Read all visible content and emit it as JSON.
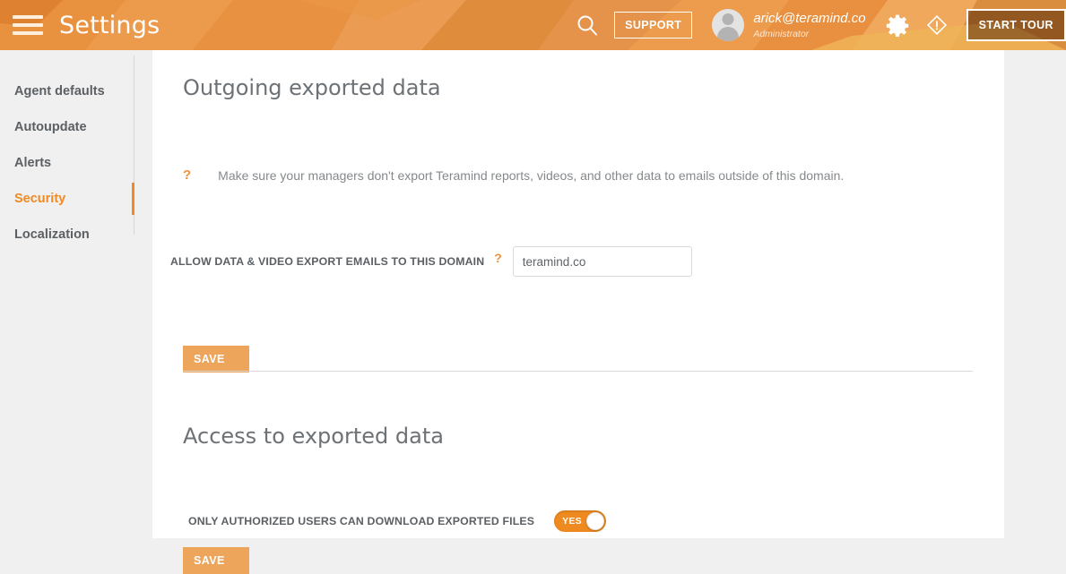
{
  "header": {
    "menu_icon": "hamburger-menu-icon",
    "title": "Settings",
    "search_icon": "search-icon",
    "support_label": "SUPPORT",
    "user_email": "arick@teramind.co",
    "user_role": "Administrator",
    "gear_icon": "gear-icon",
    "alert_icon": "alert-diamond-icon",
    "start_tour_label": "START TOUR",
    "accent_color": "#e78c3c"
  },
  "sidebar": {
    "items": [
      {
        "label": "Agent defaults",
        "active": false
      },
      {
        "label": "Autoupdate",
        "active": false
      },
      {
        "label": "Alerts",
        "active": false
      },
      {
        "label": "Security",
        "active": true
      },
      {
        "label": "Localization",
        "active": false
      }
    ],
    "active_color": "#f08a24"
  },
  "main": {
    "section_outgoing": {
      "title": "Outgoing exported data",
      "hint_icon": "question-mark-icon",
      "hint_text": "Make sure your managers don't export Teramind reports, videos, and other data to emails outside of this domain.",
      "field_label": "ALLOW DATA & VIDEO EXPORT EMAILS TO THIS DOMAIN",
      "field_help_icon": "question-mark-icon",
      "field_value": "teramind.co",
      "field_placeholder": "teramind.co",
      "save_label": "SAVE"
    },
    "section_access": {
      "title": "Access to exported data",
      "toggle_label": "ONLY AUTHORIZED USERS CAN DOWNLOAD EXPORTED FILES",
      "toggle_state": "YES",
      "save_label": "SAVE"
    }
  }
}
